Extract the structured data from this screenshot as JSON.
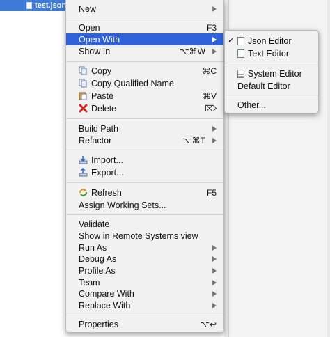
{
  "tree": {
    "selected_file": "test.json"
  },
  "menu": {
    "new": "New",
    "open": "Open",
    "open_shortcut": "F3",
    "open_with": "Open With",
    "show_in": "Show In",
    "show_in_shortcut": "⌥⌘W",
    "copy": "Copy",
    "copy_shortcut": "⌘C",
    "copy_qualified": "Copy Qualified Name",
    "paste": "Paste",
    "paste_shortcut": "⌘V",
    "delete": "Delete",
    "delete_shortcut": "⌦",
    "build_path": "Build Path",
    "refactor": "Refactor",
    "refactor_shortcut": "⌥⌘T",
    "import": "Import...",
    "export": "Export...",
    "refresh": "Refresh",
    "refresh_shortcut": "F5",
    "assign_working_sets": "Assign Working Sets...",
    "validate": "Validate",
    "show_remote": "Show in Remote Systems view",
    "run_as": "Run As",
    "debug_as": "Debug As",
    "profile_as": "Profile As",
    "team": "Team",
    "compare_with": "Compare With",
    "replace_with": "Replace With",
    "properties": "Properties",
    "properties_shortcut": "⌥↩"
  },
  "submenu": {
    "json_editor": "Json Editor",
    "text_editor": "Text Editor",
    "system_editor": "System Editor",
    "default_editor": "Default Editor",
    "other": "Other...",
    "check": "✓"
  },
  "colors": {
    "selection": "#2f62d8",
    "tree_selection": "#3d7bd6"
  }
}
